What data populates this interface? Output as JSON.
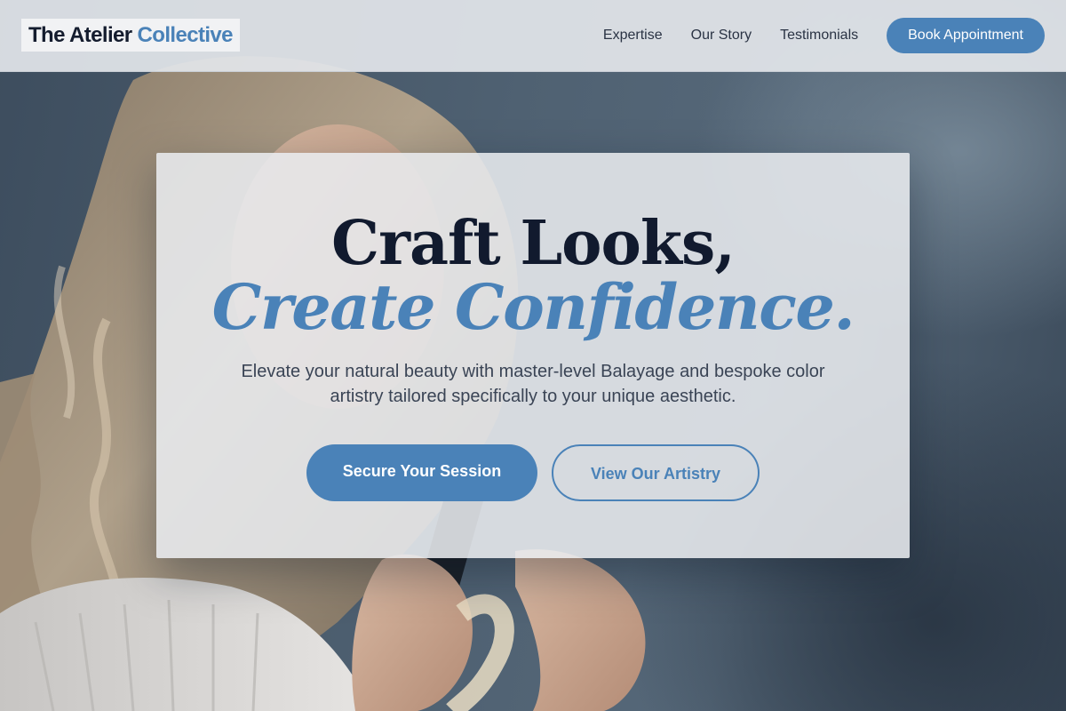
{
  "brand": {
    "name_dark": "The Atelier",
    "name_accent": "Collective"
  },
  "nav": {
    "links": [
      "Expertise",
      "Our Story",
      "Testimonials"
    ],
    "cta_label": "Book Appointment"
  },
  "hero": {
    "headline_line1": "Craft Looks,",
    "headline_line2": "Create Confidence.",
    "subtext": "Elevate your natural beauty with master-level Balayage and bespoke color artistry tailored specifically to your unique aesthetic.",
    "primary_cta": "Secure Your Session",
    "secondary_cta": "View Our Artistry"
  },
  "colors": {
    "accent": "#4a82b8",
    "dark_text": "#111a2e",
    "body_text": "#3a4455",
    "header_bg": "#e2e5e9",
    "card_bg": "#e8eaee",
    "background": "#4a5a6a"
  },
  "background_image": {
    "subject": "woman with long wavy blonde hair holding a hairbrush"
  }
}
